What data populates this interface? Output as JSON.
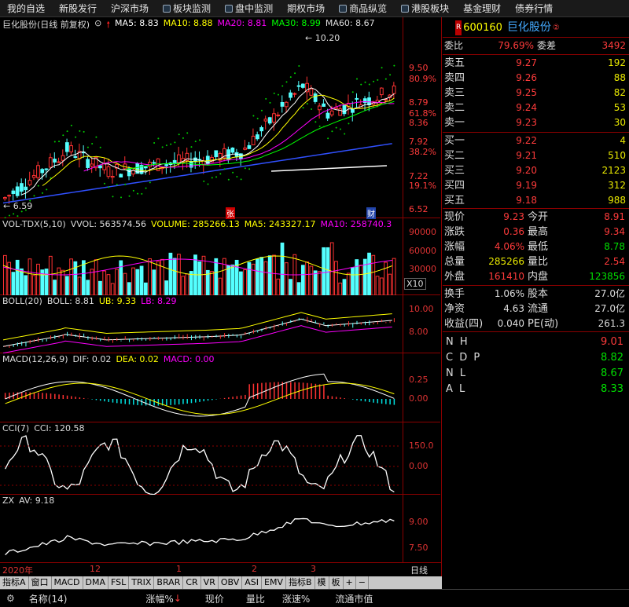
{
  "topnav": [
    "我的自选",
    "新股发行",
    "沪深市场",
    "板块监测",
    "盘中监测",
    "期权市场",
    "商品纵览",
    "港股板块",
    "基金理财",
    "债券行情"
  ],
  "main": {
    "title": "巨化股份(日线 前复权)",
    "ma": [
      {
        "label": "MA5: 8.83",
        "color": "#ffffff"
      },
      {
        "label": "MA10: 8.88",
        "color": "#ffff00"
      },
      {
        "label": "MA20: 8.81",
        "color": "#ff00ff"
      },
      {
        "label": "MA30: 8.99",
        "color": "#00ff00"
      },
      {
        "label": "MA60: 8.67",
        "color": "#dddddd"
      }
    ],
    "axis": [
      "9.50",
      "80.9%",
      "8.79",
      "61.8%",
      "8.36",
      "7.92",
      "38.2%",
      "7.22",
      "19.1%",
      "6.52"
    ],
    "high_label": "10.20",
    "low_label": "6.59",
    "mark_zhang": "张",
    "mark_cai": "财"
  },
  "vol": {
    "title": "VOL-TDX(5,10)",
    "vvol": "VVOL: 563574.56",
    "volume": "VOLUME: 285266.13",
    "ma5": "MA5: 243327.17",
    "ma10": "MA10: 258740.3",
    "axis": [
      "90000",
      "60000",
      "30000"
    ],
    "unit": "X10"
  },
  "boll": {
    "title": "BOLL(20)",
    "boll": "BOLL: 8.81",
    "ub": "UB: 9.33",
    "lb": "LB: 8.29",
    "axis": [
      "10.00",
      "8.00"
    ]
  },
  "macd": {
    "title": "MACD(12,26,9)",
    "dif": "DIF: 0.02",
    "dea": "DEA: 0.02",
    "macd": "MACD: 0.00",
    "axis": [
      "0.25",
      "0.00"
    ]
  },
  "cci": {
    "title": "CCI(7)",
    "cci": "CCI: 120.58",
    "axis": [
      "150.0",
      "0.00"
    ]
  },
  "zx": {
    "title": "ZX",
    "av": "AV: 9.18",
    "axis": [
      "9.00",
      "7.50"
    ]
  },
  "dates": [
    "2020年",
    "12",
    "1",
    "2",
    "3"
  ],
  "period": "日线",
  "tabs": [
    "指标A",
    "窗口",
    "MACD",
    "DMA",
    "FSL",
    "TRIX",
    "BRAR",
    "CR",
    "VR",
    "OBV",
    "ASI",
    "EMV",
    "指标B",
    "模",
    "板",
    "+",
    "−"
  ],
  "quote": {
    "code": "600160",
    "name": "巨化股份",
    "wb_label": "委比",
    "wb": "79.69%",
    "wc_label": "委差",
    "wc": "3492",
    "asks": [
      [
        "卖五",
        "9.27",
        "192"
      ],
      [
        "卖四",
        "9.26",
        "88"
      ],
      [
        "卖三",
        "9.25",
        "82"
      ],
      [
        "卖二",
        "9.24",
        "53"
      ],
      [
        "卖一",
        "9.23",
        "30"
      ]
    ],
    "bids": [
      [
        "买一",
        "9.22",
        "4"
      ],
      [
        "买二",
        "9.21",
        "510"
      ],
      [
        "买三",
        "9.20",
        "2123"
      ],
      [
        "买四",
        "9.19",
        "312"
      ],
      [
        "买五",
        "9.18",
        "988"
      ]
    ],
    "stats": [
      [
        "现价",
        "9.23",
        "今开",
        "8.91"
      ],
      [
        "涨跌",
        "0.36",
        "最高",
        "9.34"
      ],
      [
        "涨幅",
        "4.06%",
        "最低",
        "8.78"
      ],
      [
        "总量",
        "285266",
        "量比",
        "2.54"
      ],
      [
        "外盘",
        "161410",
        "内盘",
        "123856"
      ]
    ],
    "fin": [
      [
        "换手",
        "1.06%",
        "股本",
        "27.0亿"
      ],
      [
        "净资",
        "4.63",
        "流通",
        "27.0亿"
      ],
      [
        "收益(四)",
        "0.040",
        "PE(动)",
        "261.3"
      ]
    ],
    "extra": [
      [
        "N H",
        "9.01"
      ],
      [
        "C D P",
        "8.82"
      ],
      [
        "N L",
        "8.67"
      ],
      [
        "A L",
        "8.33"
      ]
    ]
  },
  "bottom": [
    "名称(14)",
    "涨幅%",
    "现价",
    "量比",
    "涨速%",
    "流通市值"
  ]
}
